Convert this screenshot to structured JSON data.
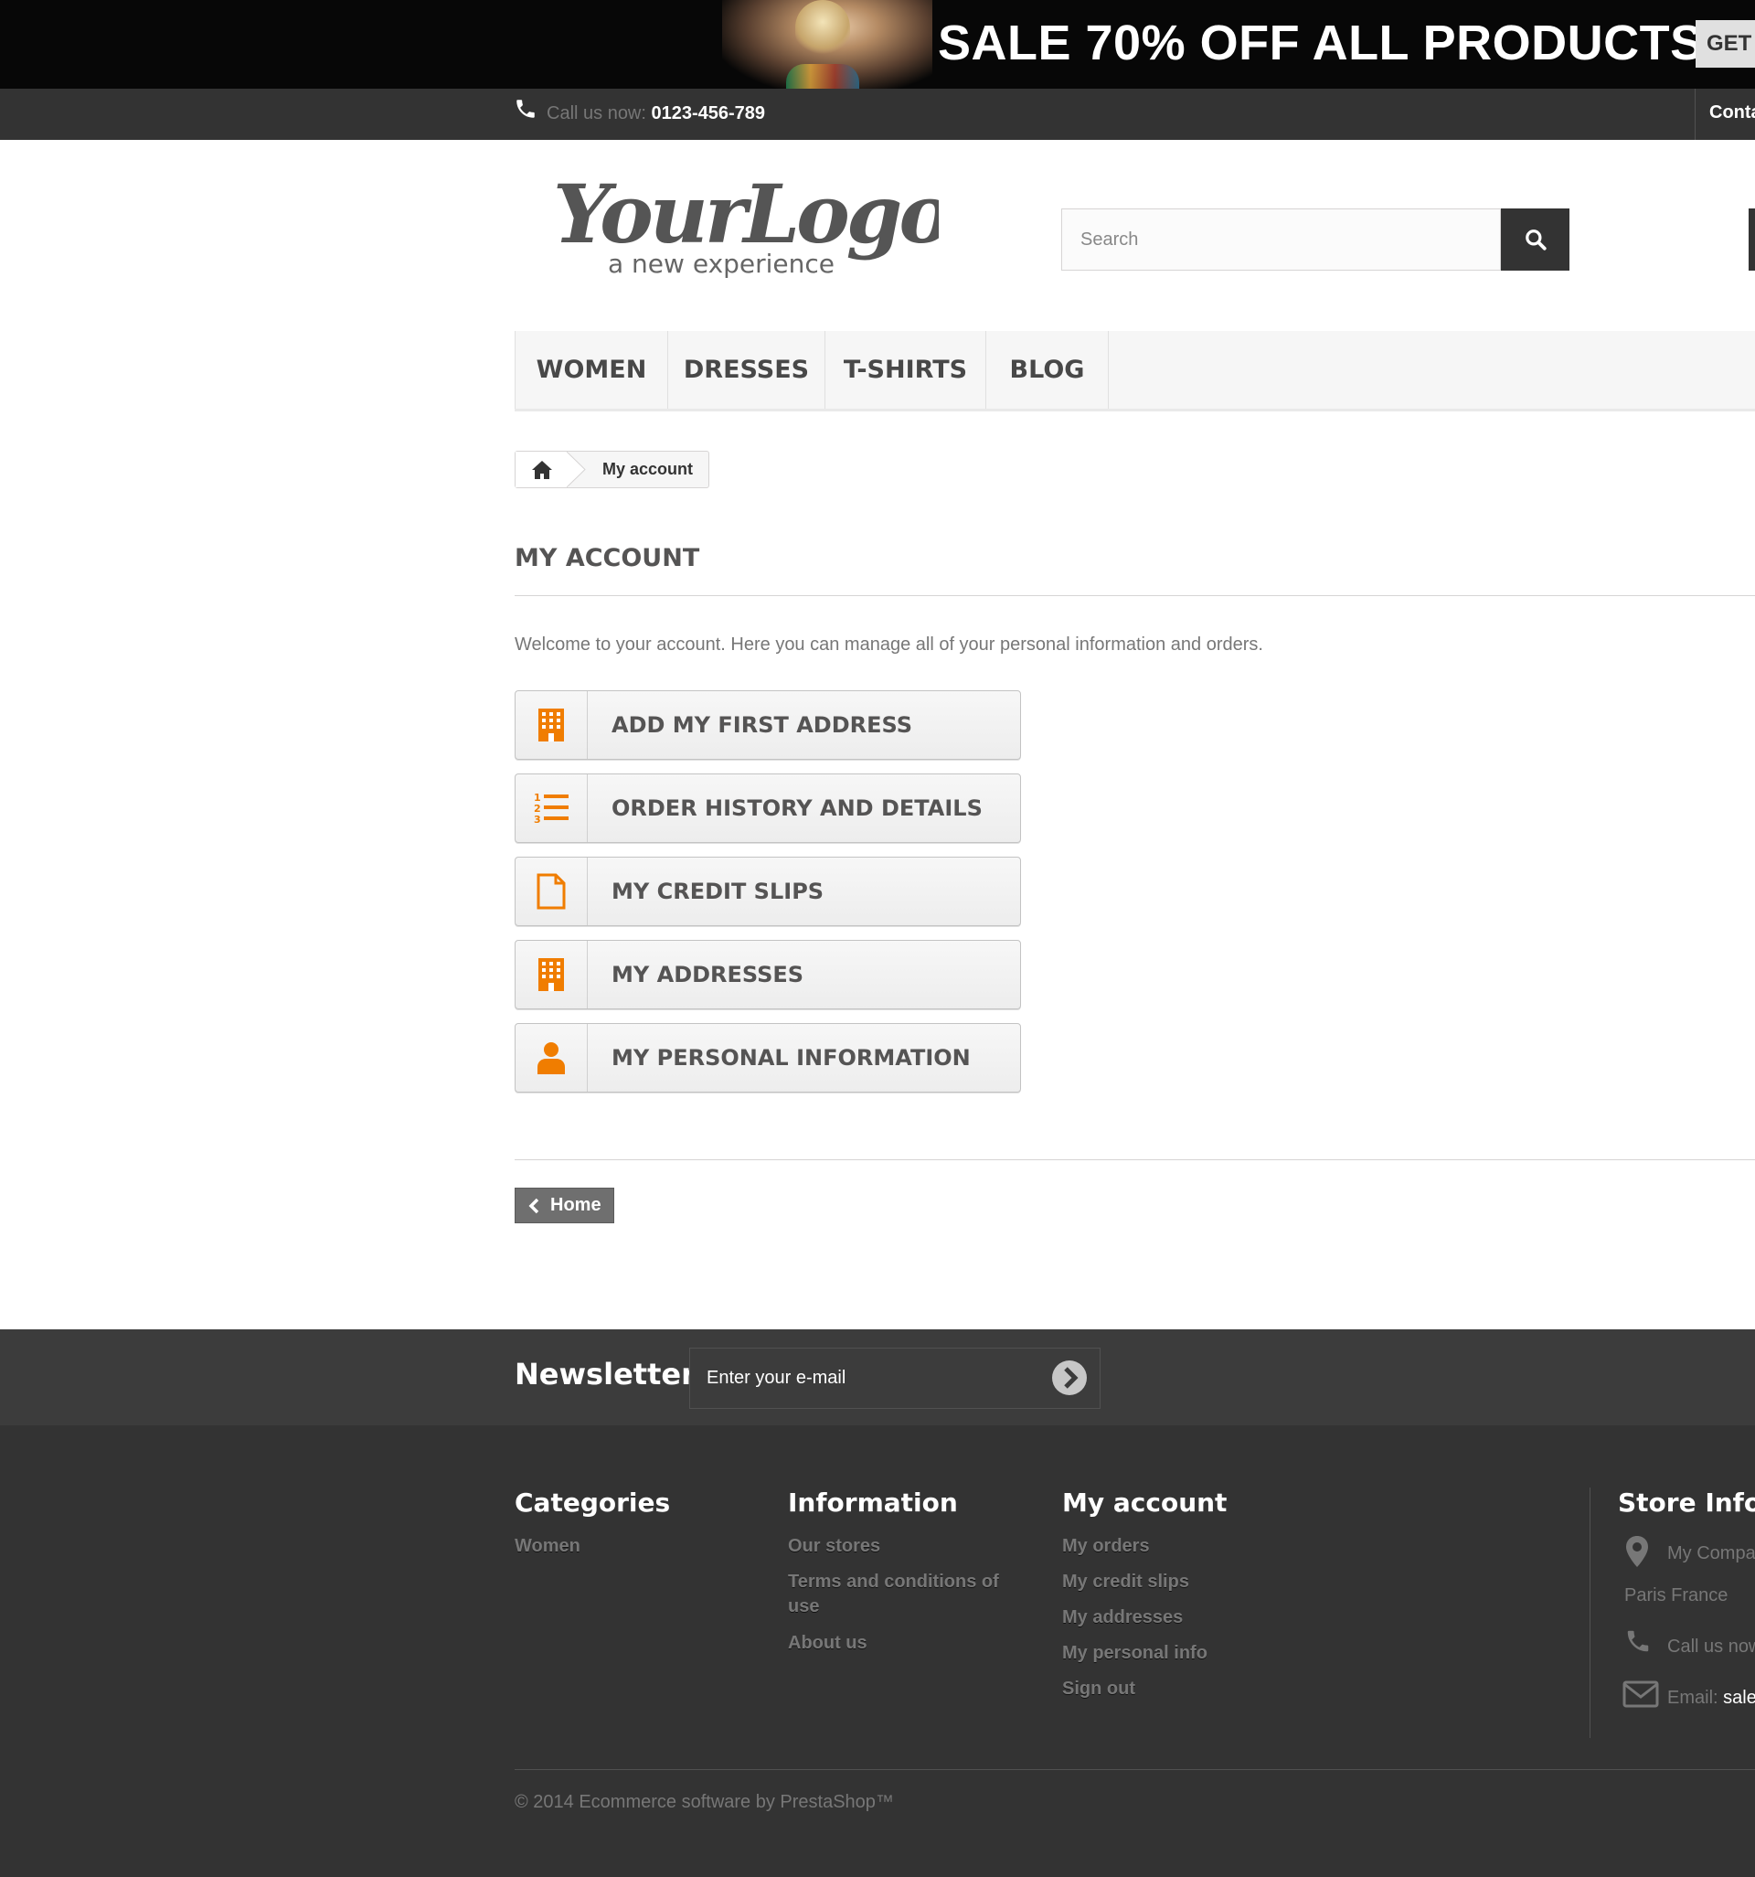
{
  "banner": {
    "headline": "SALE 70% OFF ALL PRODUCTS",
    "button_label": "GET S"
  },
  "topbar": {
    "call_label": "Call us now: ",
    "call_number": "0123-456-789",
    "contact_label": "Conta"
  },
  "header": {
    "logo_text": "YourLogo",
    "logo_tagline": "a new experience",
    "search_placeholder": "Search"
  },
  "menu": {
    "items": [
      "WOMEN",
      "DRESSES",
      "T-SHIRTS",
      "BLOG"
    ]
  },
  "breadcrumb": {
    "current": "My account"
  },
  "page": {
    "title": "MY ACCOUNT",
    "welcome": "Welcome to your account. Here you can manage all of your personal information and orders.",
    "buttons": [
      {
        "label": "ADD MY FIRST ADDRESS",
        "icon": "building-icon"
      },
      {
        "label": "ORDER HISTORY AND DETAILS",
        "icon": "ordered-list-icon"
      },
      {
        "label": "MY CREDIT SLIPS",
        "icon": "file-icon"
      },
      {
        "label": "MY ADDRESSES",
        "icon": "building-icon"
      },
      {
        "label": "MY PERSONAL INFORMATION",
        "icon": "user-icon"
      }
    ],
    "home_button": "Home"
  },
  "newsletter": {
    "title": "Newsletter",
    "placeholder": "Enter your e-mail"
  },
  "footer": {
    "categories": {
      "title": "Categories",
      "links": [
        "Women"
      ]
    },
    "information": {
      "title": "Information",
      "links": [
        "Our stores",
        "Terms and conditions of use",
        "About us"
      ]
    },
    "account": {
      "title": "My account",
      "links": [
        "My orders",
        "My credit slips",
        "My addresses",
        "My personal info",
        "Sign out"
      ]
    },
    "store": {
      "title": "Store Inform",
      "company": "My Compa",
      "city": "Paris France",
      "call": "Call us now",
      "email_label": "Email: ",
      "email_value": "sale"
    },
    "copyright": "© 2014 Ecommerce software by PrestaShop™"
  },
  "colors": {
    "accent": "#f07d00",
    "dark": "#333333",
    "banner_bg": "#070707"
  }
}
